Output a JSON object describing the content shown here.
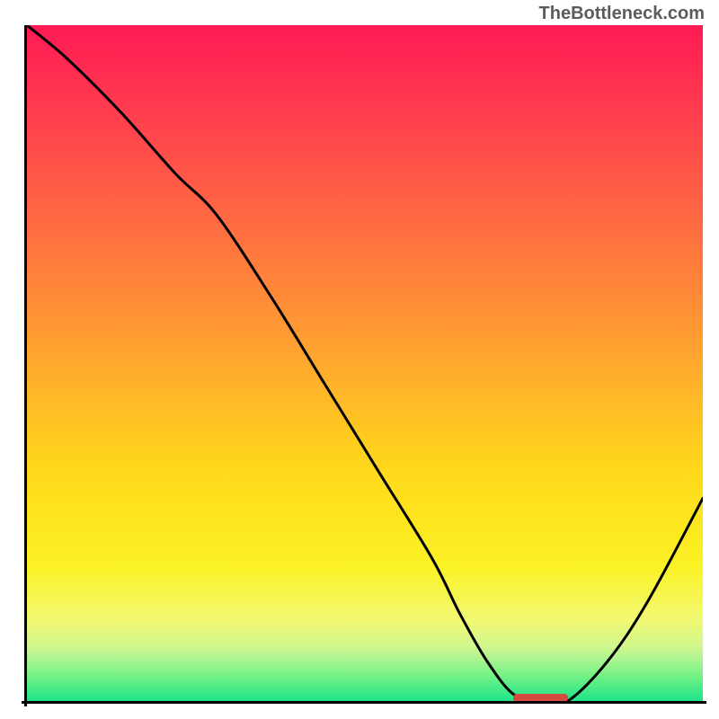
{
  "watermark": "TheBottleneck.com",
  "chart_data": {
    "type": "line",
    "title": "",
    "xlabel": "",
    "ylabel": "",
    "xlim": [
      0,
      100
    ],
    "ylim": [
      0,
      100
    ],
    "x": [
      0,
      6,
      14,
      22,
      28,
      36,
      44,
      52,
      60,
      64,
      68,
      72,
      76,
      80,
      86,
      92,
      100
    ],
    "values": [
      100,
      95,
      87,
      78,
      72,
      60,
      47,
      34,
      21,
      13,
      6,
      1,
      0,
      0,
      6,
      15,
      30
    ],
    "marker": {
      "x_start": 72,
      "x_end": 80,
      "y": 0
    },
    "background_gradient": {
      "direction": "vertical",
      "stops": [
        {
          "pos": 0.0,
          "color": "#ff1a54"
        },
        {
          "pos": 0.5,
          "color": "#ffc020"
        },
        {
          "pos": 0.85,
          "color": "#fbf224"
        },
        {
          "pos": 1.0,
          "color": "#1fe289"
        }
      ]
    }
  }
}
